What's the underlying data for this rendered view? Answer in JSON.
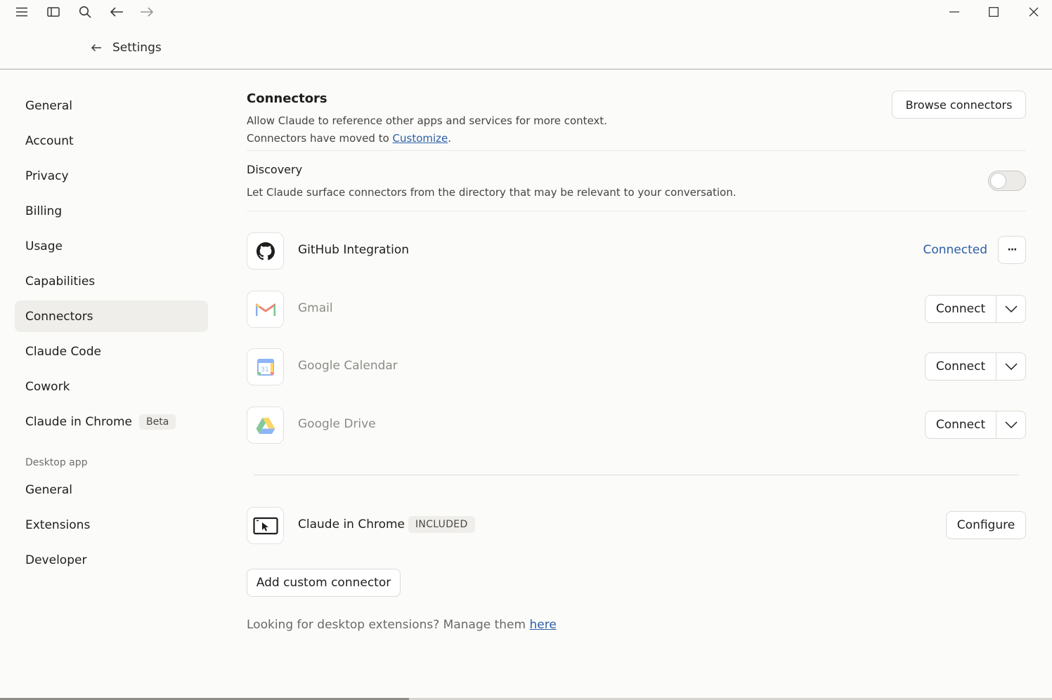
{
  "header": {
    "settings_title": "Settings"
  },
  "sidebar": {
    "items": [
      {
        "label": "General"
      },
      {
        "label": "Account"
      },
      {
        "label": "Privacy"
      },
      {
        "label": "Billing"
      },
      {
        "label": "Usage"
      },
      {
        "label": "Capabilities"
      },
      {
        "label": "Connectors"
      },
      {
        "label": "Claude Code"
      },
      {
        "label": "Cowork"
      },
      {
        "label": "Claude in Chrome",
        "badge": "Beta"
      }
    ],
    "desktop_section": "Desktop app",
    "desktop_items": [
      {
        "label": "General"
      },
      {
        "label": "Extensions"
      },
      {
        "label": "Developer"
      }
    ]
  },
  "main": {
    "title": "Connectors",
    "description": "Allow Claude to reference other apps and services for more context.",
    "moved_prefix": "Connectors have moved to ",
    "moved_link": "Customize",
    "moved_suffix": ".",
    "browse_button": "Browse connectors",
    "discovery": {
      "title": "Discovery",
      "description": "Let Claude surface connectors from the directory that may be relevant to your conversation.",
      "enabled": false
    },
    "connectors": [
      {
        "name": "GitHub Integration",
        "status": "Connected",
        "more": "···"
      },
      {
        "name": "Gmail",
        "action": "Connect"
      },
      {
        "name": "Google Calendar",
        "action": "Connect",
        "calendar_day": "31"
      },
      {
        "name": "Google Drive",
        "action": "Connect"
      }
    ],
    "chrome": {
      "name": "Claude in Chrome",
      "badge": "INCLUDED",
      "button": "Configure"
    },
    "add_custom": "Add custom connector",
    "footer_prefix": "Looking for desktop extensions? Manage them ",
    "footer_link": "here"
  },
  "colors": {
    "accent_link": "#2c5ea8",
    "background": "#fbfbf9",
    "active_nav": "#efeeeb"
  }
}
